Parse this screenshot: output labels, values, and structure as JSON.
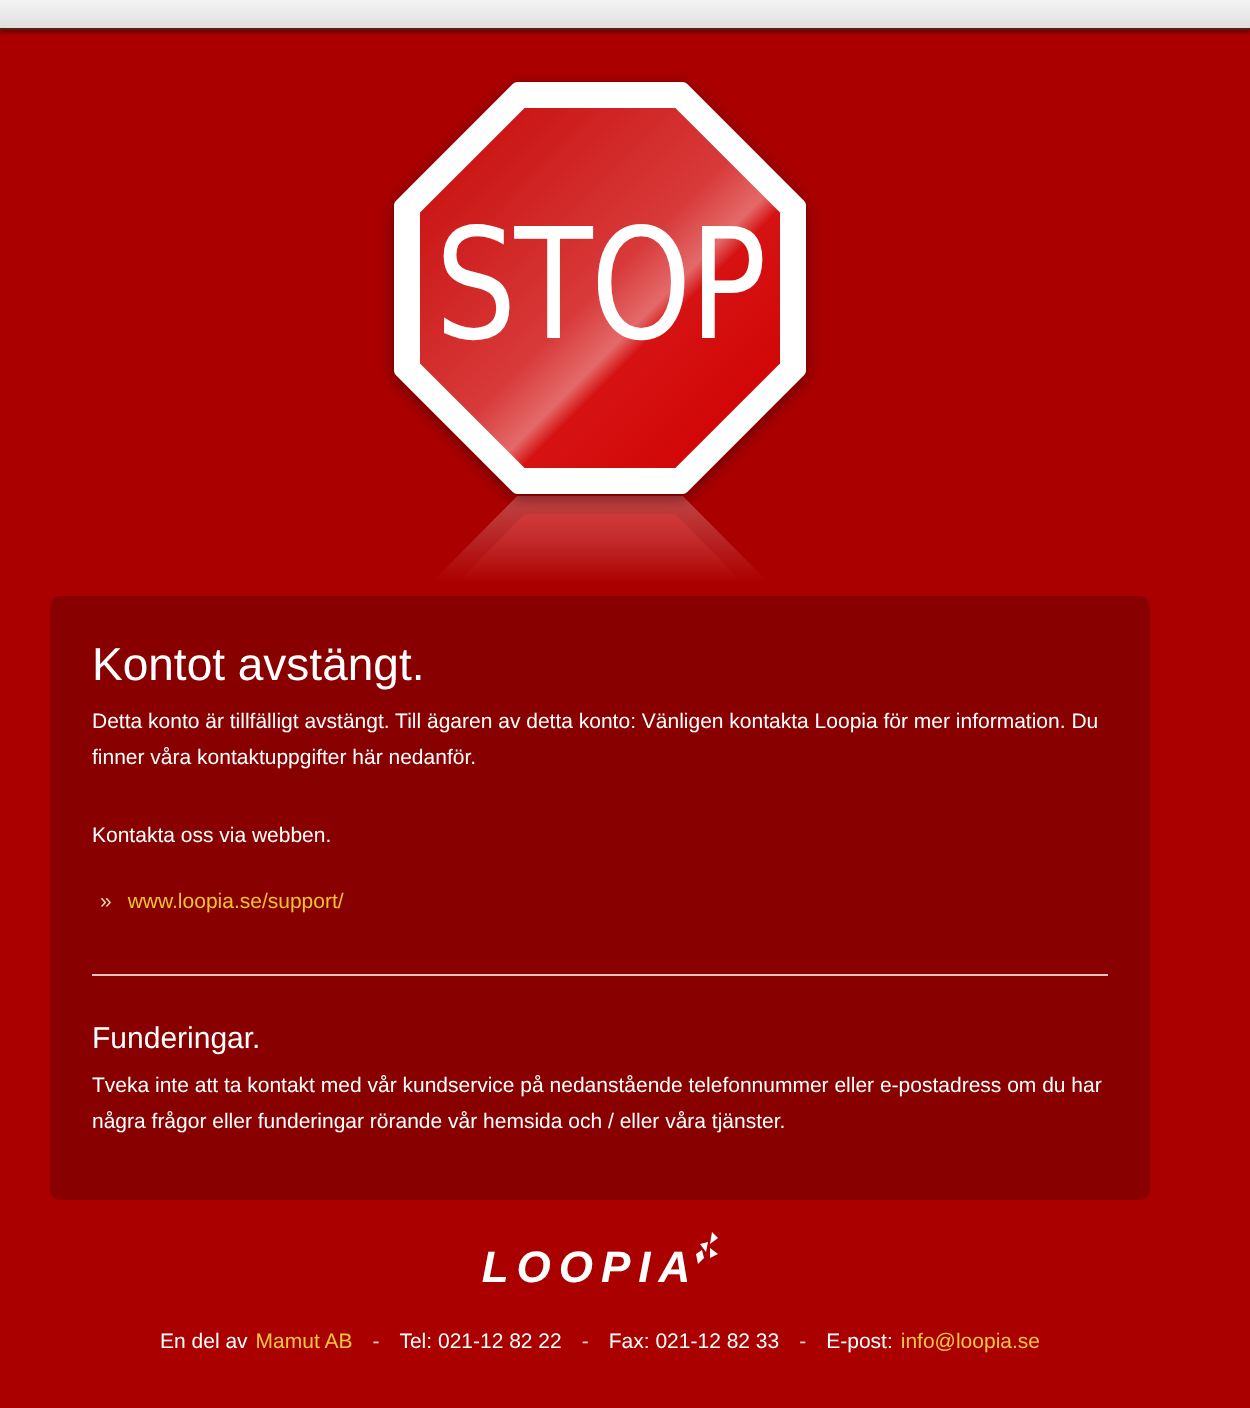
{
  "sign": {
    "text": "STOP"
  },
  "notice": {
    "title": "Kontot avstängt.",
    "message": "Detta konto är tillfälligt avstängt. Till ägaren av detta konto: Vänligen kontakta Loopia för mer information. Du finner våra kontaktuppgifter här nedanför.",
    "contact_prompt": "Kontakta oss via webben.",
    "links": [
      {
        "bullet": "»",
        "text": "www.loopia.se/support/"
      }
    ]
  },
  "questions": {
    "title": "Funderingar.",
    "message": "Tveka inte att ta kontakt med vår kundservice på nedanstående telefonnummer eller e-postadress om du har några frågor eller funderingar rörande vår hemsida och / eller våra tjänster."
  },
  "logo": {
    "text": "LOOPIA"
  },
  "footer": {
    "parts": [
      {
        "kind": "text",
        "text": "En del av"
      },
      {
        "kind": "link",
        "text": "Mamut AB"
      },
      {
        "kind": "separator",
        "text": "-"
      },
      {
        "kind": "text",
        "text": "Tel: 021-12 82 22"
      },
      {
        "kind": "separator",
        "text": "-"
      },
      {
        "kind": "text",
        "text": "Fax: 021-12 82 33"
      },
      {
        "kind": "separator",
        "text": "-"
      },
      {
        "kind": "text",
        "text": "E-post:"
      },
      {
        "kind": "link",
        "text": "info@loopia.se"
      }
    ]
  }
}
